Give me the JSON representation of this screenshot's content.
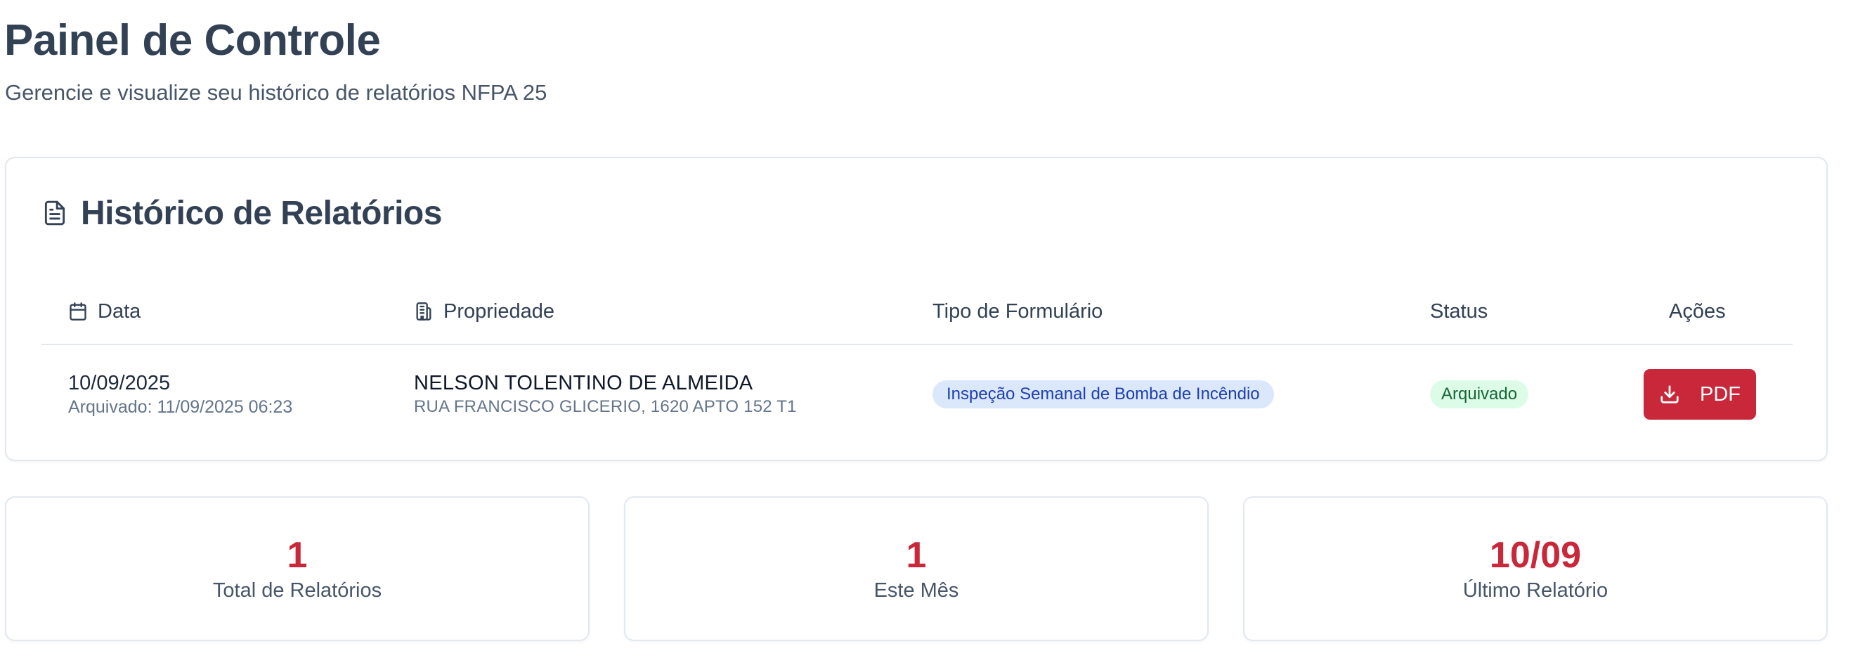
{
  "header": {
    "title": "Painel de Controle",
    "subtitle": "Gerencie e visualize seu histórico de relatórios NFPA 25"
  },
  "history": {
    "title": "Histórico de Relatórios",
    "icon": "document-icon",
    "columns": {
      "date": "Data",
      "property": "Propriedade",
      "form_type": "Tipo de Formulário",
      "status": "Status",
      "actions": "Ações"
    },
    "rows": [
      {
        "date": "10/09/2025",
        "archived": "Arquivado: 11/09/2025 06:23",
        "property_name": "NELSON TOLENTINO DE ALMEIDA",
        "property_address": "RUA FRANCISCO GLICERIO, 1620 APTO 152 T1",
        "form_type": "Inspeção Semanal de Bomba de Incêndio",
        "status": "Arquivado",
        "action_label": "PDF"
      }
    ]
  },
  "stats": [
    {
      "value": "1",
      "label": "Total de Relatórios"
    },
    {
      "value": "1",
      "label": "Este Mês"
    },
    {
      "value": "10/09",
      "label": "Último Relatório"
    }
  ],
  "colors": {
    "accent": "#c8283a",
    "form_badge_bg": "#dbe7fb",
    "form_badge_text": "#1e40af",
    "status_badge_bg": "#dcfce7",
    "status_badge_text": "#166534"
  }
}
